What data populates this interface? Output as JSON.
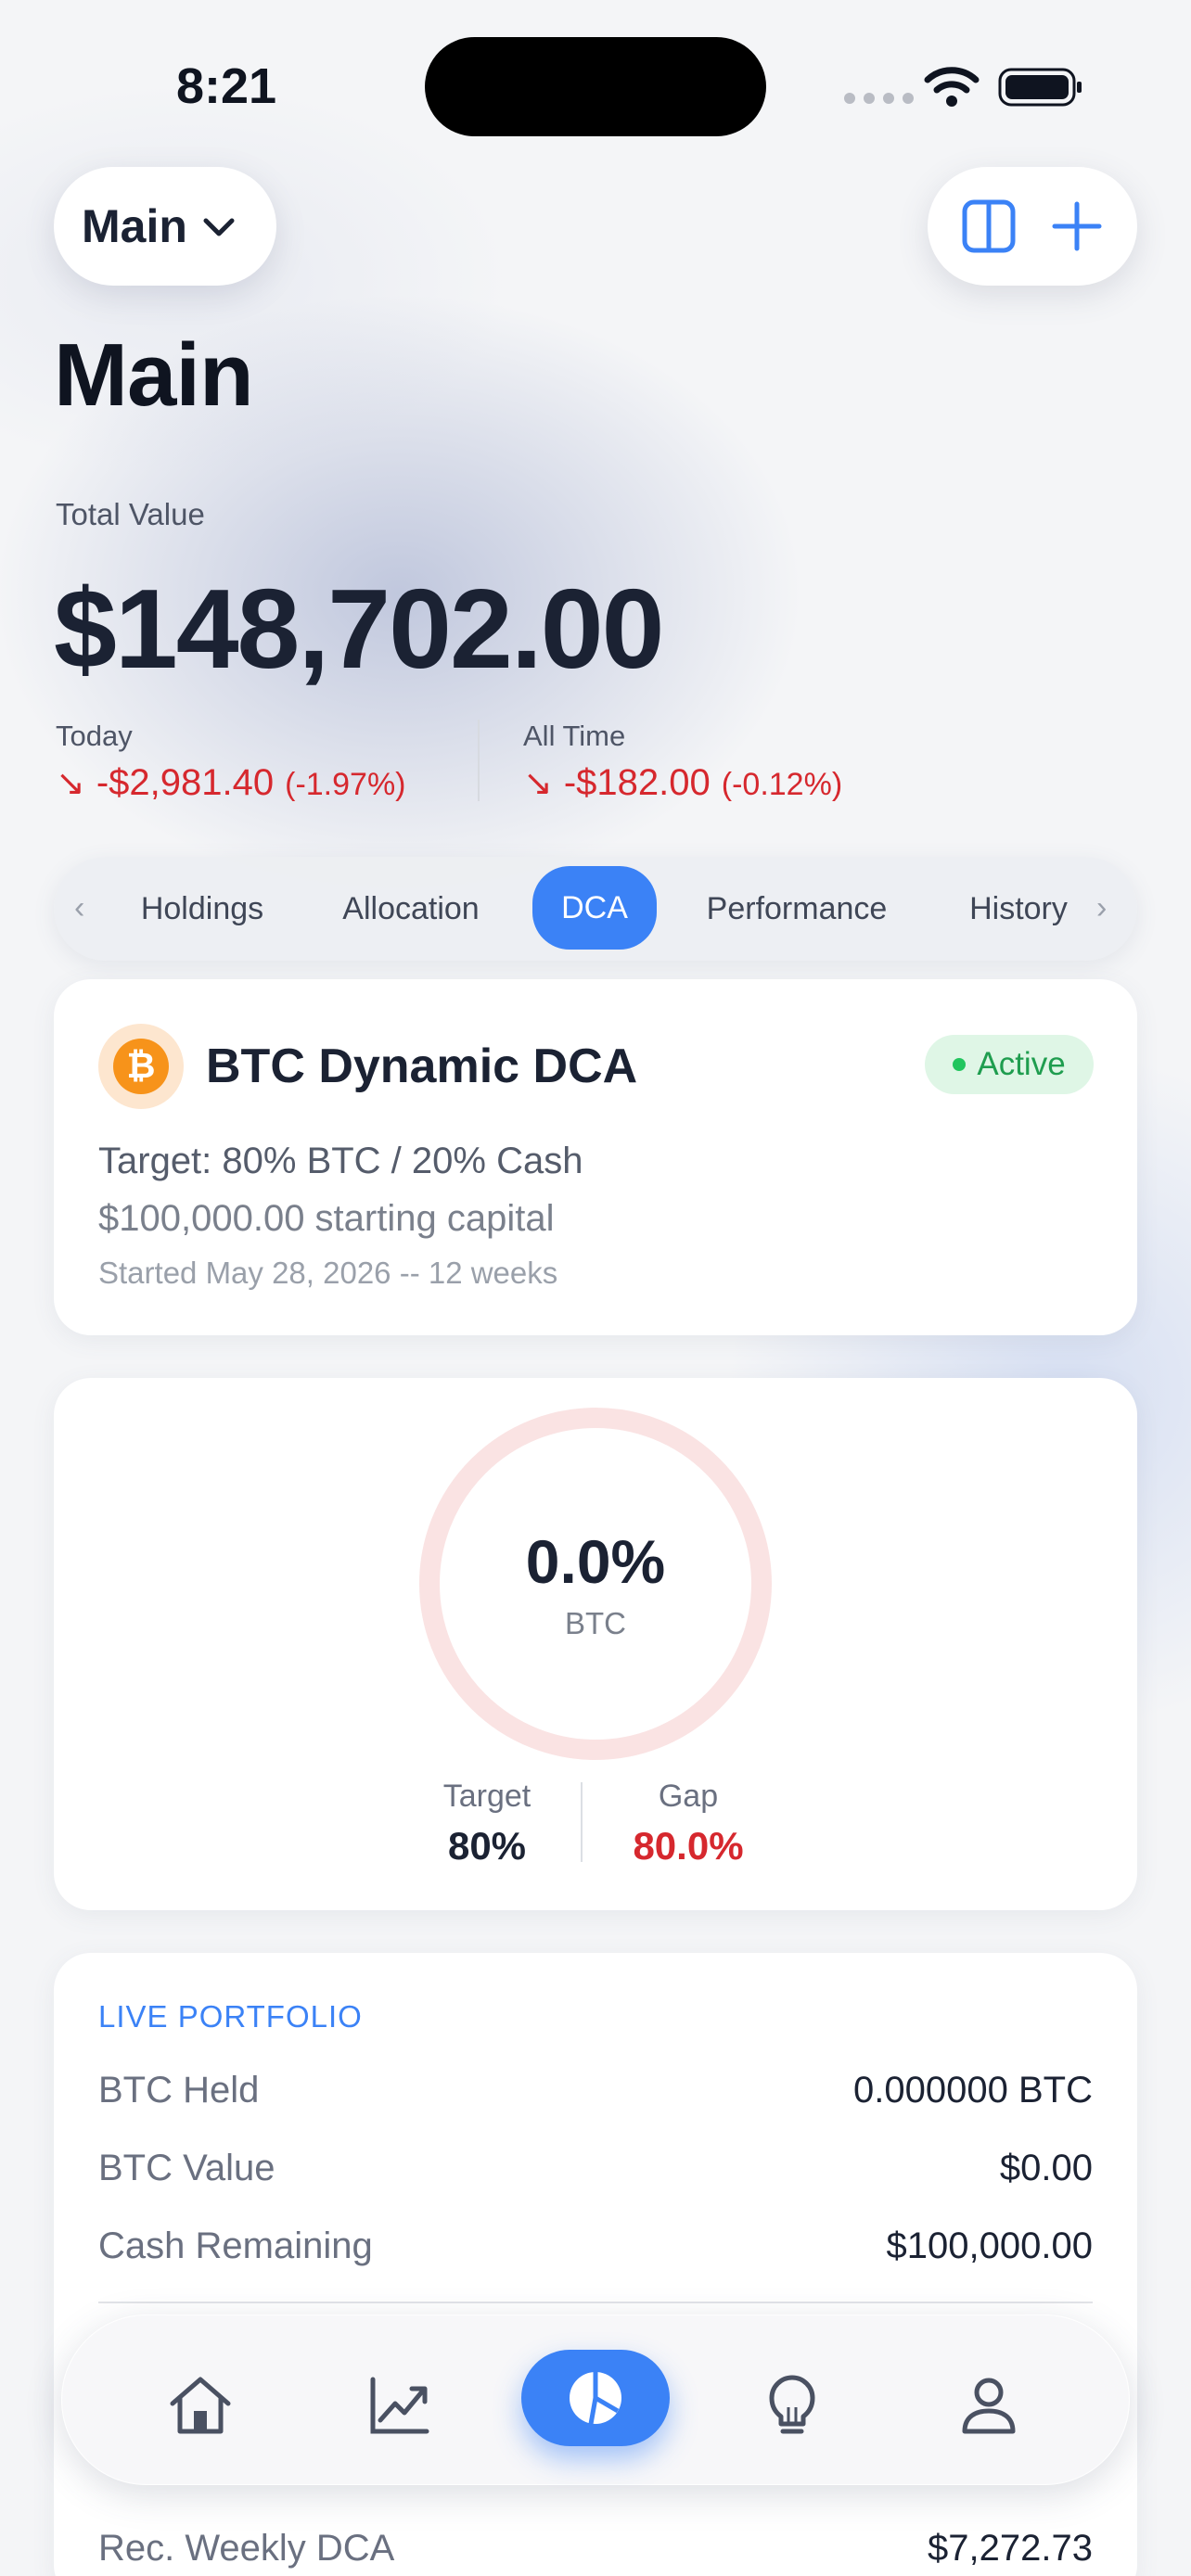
{
  "status": {
    "time": "8:21"
  },
  "header": {
    "portfolio_selector": "Main",
    "title": "Main"
  },
  "summary": {
    "total_label": "Total Value",
    "total_value": "$148,702.00",
    "today_label": "Today",
    "today_change": "-$2,981.40",
    "today_pct": "(-1.97%)",
    "alltime_label": "All Time",
    "alltime_change": "-$182.00",
    "alltime_pct": "(-0.12%)",
    "arrow": "↘"
  },
  "tabs": [
    {
      "label": "Holdings"
    },
    {
      "label": "Allocation"
    },
    {
      "label": "DCA",
      "active": true
    },
    {
      "label": "Performance"
    },
    {
      "label": "History"
    }
  ],
  "strategy": {
    "icon": "bitcoin-icon",
    "icon_glyph": "₿",
    "name": "BTC Dynamic DCA",
    "status": "Active",
    "target": "Target: 80% BTC / 20% Cash",
    "capital": "$100,000.00 starting capital",
    "started": "Started May 28, 2026 -- 12 weeks"
  },
  "allocation": {
    "current_pct": "0.0%",
    "asset": "BTC",
    "current_fraction": 0.0,
    "target_label": "Target",
    "target_value": "80%",
    "gap_label": "Gap",
    "gap_value": "80.0%"
  },
  "live_portfolio": {
    "heading": "LIVE PORTFOLIO",
    "rows": [
      {
        "label": "BTC Held",
        "value": "0.000000 BTC"
      },
      {
        "label": "BTC Value",
        "value": "$0.00"
      },
      {
        "label": "Cash Remaining",
        "value": "$100,000.00"
      },
      {
        "label": "Rec. Weekly DCA",
        "value": "$7,272.73"
      }
    ]
  },
  "bottom_nav": [
    {
      "icon": "home-icon"
    },
    {
      "icon": "chart-icon"
    },
    {
      "icon": "pie-chart-icon",
      "active": true
    },
    {
      "icon": "lightbulb-icon"
    },
    {
      "icon": "profile-icon"
    }
  ],
  "colors": {
    "accent": "#3b82f6",
    "negative": "#d6282e",
    "positive": "#1f9d4f",
    "bitcoin": "#f7931a"
  }
}
